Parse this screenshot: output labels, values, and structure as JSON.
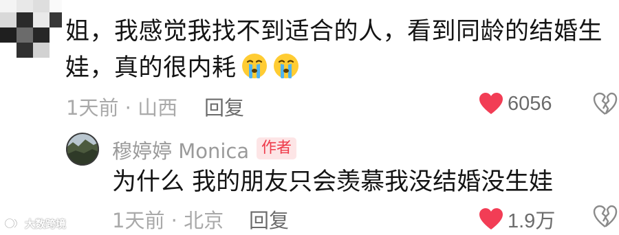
{
  "comment": {
    "line1": "姐，我感觉我找不到适合的人，看到同龄的结婚生",
    "line2": "娃，真的很内耗",
    "emoji_icons": [
      "crying-face-icon",
      "crying-face-icon"
    ],
    "time_location": "1天前 · 山西",
    "reply_label": "回复",
    "like_count": "6056",
    "liked": true
  },
  "reply": {
    "author_name": "穆婷婷 Monica",
    "author_badge": "作者",
    "text": "为什么 我的朋友只会羡慕我没结婚没生娃",
    "time_location": "1天前 · 北京",
    "reply_label": "回复",
    "like_count": "1.9万",
    "liked": true
  },
  "watermark": {
    "text": "大数跨境"
  },
  "colors": {
    "like_red": "#f23d55",
    "badge_bg": "#fde5e6",
    "badge_text": "#ee3a4a",
    "meta_gray": "#a9a9a9"
  }
}
